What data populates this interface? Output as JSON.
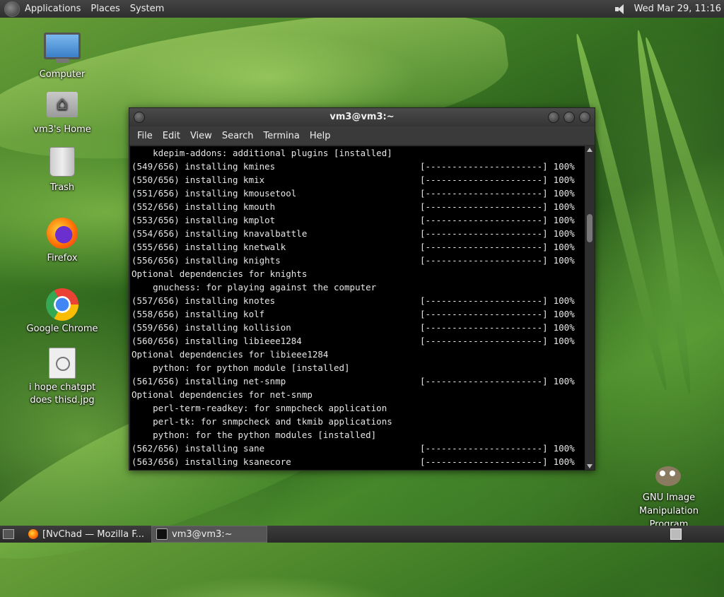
{
  "top_panel": {
    "menus": [
      "Applications",
      "Places",
      "System"
    ],
    "clock": "Wed Mar 29, 11:16"
  },
  "desktop_icons": [
    {
      "label": "Computer",
      "icon": "computer-icon"
    },
    {
      "label": "vm3's Home",
      "icon": "home-folder-icon"
    },
    {
      "label": "Trash",
      "icon": "trash-icon"
    },
    {
      "label": "Firefox",
      "icon": "firefox-icon"
    },
    {
      "label": "Google Chrome",
      "icon": "chrome-icon"
    },
    {
      "label": "i hope chatgpt does thisd.jpg",
      "icon": "image-file-icon"
    },
    {
      "label": "GNU Image Manipulation Program",
      "icon": "gimp-icon"
    }
  ],
  "terminal": {
    "title": "vm3@vm3:~",
    "menu": [
      "File",
      "Edit",
      "View",
      "Search",
      "Termina",
      "Help"
    ],
    "lines": [
      {
        "text": "    kdepim-addons: additional plugins [installed]",
        "bar": "",
        "pct": ""
      },
      {
        "text": "(549/656) installing kmines",
        "bar": "[----------------------]",
        "pct": "100%"
      },
      {
        "text": "(550/656) installing kmix",
        "bar": "[----------------------]",
        "pct": "100%"
      },
      {
        "text": "(551/656) installing kmousetool",
        "bar": "[----------------------]",
        "pct": "100%"
      },
      {
        "text": "(552/656) installing kmouth",
        "bar": "[----------------------]",
        "pct": "100%"
      },
      {
        "text": "(553/656) installing kmplot",
        "bar": "[----------------------]",
        "pct": "100%"
      },
      {
        "text": "(554/656) installing knavalbattle",
        "bar": "[----------------------]",
        "pct": "100%"
      },
      {
        "text": "(555/656) installing knetwalk",
        "bar": "[----------------------]",
        "pct": "100%"
      },
      {
        "text": "(556/656) installing knights",
        "bar": "[----------------------]",
        "pct": "100%"
      },
      {
        "text": "Optional dependencies for knights",
        "bar": "",
        "pct": ""
      },
      {
        "text": "    gnuchess: for playing against the computer",
        "bar": "",
        "pct": ""
      },
      {
        "text": "(557/656) installing knotes",
        "bar": "[----------------------]",
        "pct": "100%"
      },
      {
        "text": "(558/656) installing kolf",
        "bar": "[----------------------]",
        "pct": "100%"
      },
      {
        "text": "(559/656) installing kollision",
        "bar": "[----------------------]",
        "pct": "100%"
      },
      {
        "text": "(560/656) installing libieee1284",
        "bar": "[----------------------]",
        "pct": "100%"
      },
      {
        "text": "Optional dependencies for libieee1284",
        "bar": "",
        "pct": ""
      },
      {
        "text": "    python: for python module [installed]",
        "bar": "",
        "pct": ""
      },
      {
        "text": "(561/656) installing net-snmp",
        "bar": "[----------------------]",
        "pct": "100%"
      },
      {
        "text": "Optional dependencies for net-snmp",
        "bar": "",
        "pct": ""
      },
      {
        "text": "    perl-term-readkey: for snmpcheck application",
        "bar": "",
        "pct": ""
      },
      {
        "text": "    perl-tk: for snmpcheck and tkmib applications",
        "bar": "",
        "pct": ""
      },
      {
        "text": "    python: for the python modules [installed]",
        "bar": "",
        "pct": ""
      },
      {
        "text": "(562/656) installing sane",
        "bar": "[----------------------]",
        "pct": "100%"
      },
      {
        "text": "(563/656) installing ksanecore",
        "bar": "[----------------------]",
        "pct": "100%"
      }
    ]
  },
  "taskbar": {
    "tasks": [
      {
        "label": "[NvChad — Mozilla F...",
        "icon": "firefox-icon",
        "active": false
      },
      {
        "label": "vm3@vm3:~",
        "icon": "terminal-icon",
        "active": true
      }
    ]
  }
}
